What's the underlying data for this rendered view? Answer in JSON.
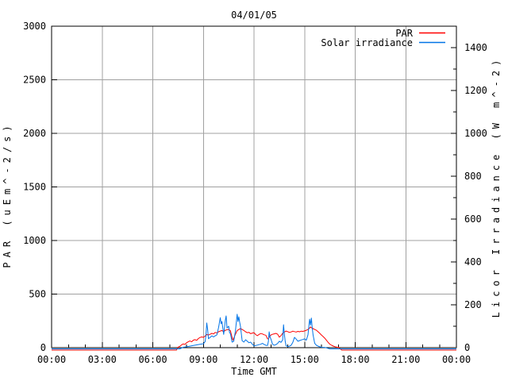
{
  "chart_data": {
    "type": "line",
    "title": "04/01/05",
    "xlabel": "Time GMT",
    "xlim": [
      0,
      24
    ],
    "x_ticks_hours": [
      0,
      3,
      6,
      9,
      12,
      15,
      18,
      21,
      24
    ],
    "x_tick_labels": [
      "00:00",
      "03:00",
      "06:00",
      "09:00",
      "12:00",
      "15:00",
      "18:00",
      "21:00",
      "00:00"
    ],
    "x_minor_step_hours": 1,
    "left_axis": {
      "label": "PAR (uEm^-2/s)",
      "lim": [
        0,
        3000
      ],
      "tick_step": 500,
      "tick_values": [
        0,
        500,
        1000,
        1500,
        2000,
        2500,
        3000
      ],
      "tick_labels": [
        "0",
        "500",
        "1000",
        "1500",
        "2000",
        "2500",
        "3000"
      ]
    },
    "right_axis": {
      "label": "Licor Irradiance (W m^-2)",
      "lim": [
        0,
        1500
      ],
      "tick_step": 200,
      "minor_step": 100,
      "tick_values": [
        0,
        200,
        400,
        600,
        800,
        1000,
        1200,
        1400
      ],
      "tick_labels": [
        "0",
        "200",
        "400",
        "600",
        "800",
        "1000",
        "1200",
        "1400"
      ]
    },
    "grid": {
      "shown": true,
      "color": "#a0a0a0"
    },
    "border_color": "#000000",
    "legend_position": "top-right-inside",
    "series": [
      {
        "name": "PAR",
        "color": "#ff0000",
        "axis": "left",
        "points": [
          [
            0,
            0
          ],
          [
            1,
            0
          ],
          [
            2,
            0
          ],
          [
            3,
            0
          ],
          [
            4,
            0
          ],
          [
            5,
            0
          ],
          [
            6,
            0
          ],
          [
            7,
            0
          ],
          [
            7.4,
            0
          ],
          [
            7.5,
            5
          ],
          [
            7.6,
            12
          ],
          [
            7.7,
            25
          ],
          [
            7.8,
            35
          ],
          [
            7.9,
            30
          ],
          [
            8.0,
            45
          ],
          [
            8.1,
            55
          ],
          [
            8.2,
            62
          ],
          [
            8.3,
            55
          ],
          [
            8.4,
            70
          ],
          [
            8.5,
            75
          ],
          [
            8.6,
            68
          ],
          [
            8.7,
            85
          ],
          [
            8.8,
            95
          ],
          [
            8.9,
            100
          ],
          [
            9.0,
            96
          ],
          [
            9.1,
            108
          ],
          [
            9.2,
            122
          ],
          [
            9.3,
            118
          ],
          [
            9.4,
            125
          ],
          [
            9.5,
            133
          ],
          [
            9.6,
            128
          ],
          [
            9.7,
            142
          ],
          [
            9.8,
            138
          ],
          [
            9.9,
            148
          ],
          [
            10.0,
            155
          ],
          [
            10.1,
            160
          ],
          [
            10.2,
            150
          ],
          [
            10.3,
            162
          ],
          [
            10.4,
            168
          ],
          [
            10.5,
            170
          ],
          [
            10.6,
            158
          ],
          [
            10.7,
            95
          ],
          [
            10.75,
            70
          ],
          [
            10.8,
            88
          ],
          [
            10.9,
            125
          ],
          [
            11.0,
            160
          ],
          [
            11.1,
            170
          ],
          [
            11.2,
            178
          ],
          [
            11.3,
            170
          ],
          [
            11.4,
            160
          ],
          [
            11.5,
            148
          ],
          [
            11.6,
            140
          ],
          [
            11.7,
            143
          ],
          [
            11.8,
            130
          ],
          [
            11.9,
            136
          ],
          [
            12.0,
            140
          ],
          [
            12.1,
            122
          ],
          [
            12.2,
            112
          ],
          [
            12.3,
            124
          ],
          [
            12.4,
            132
          ],
          [
            12.5,
            128
          ],
          [
            12.6,
            120
          ],
          [
            12.7,
            116
          ],
          [
            12.8,
            84
          ],
          [
            12.85,
            80
          ],
          [
            12.9,
            100
          ],
          [
            13.0,
            118
          ],
          [
            13.1,
            125
          ],
          [
            13.2,
            129
          ],
          [
            13.3,
            133
          ],
          [
            13.4,
            125
          ],
          [
            13.5,
            98
          ],
          [
            13.6,
            112
          ],
          [
            13.7,
            134
          ],
          [
            13.8,
            146
          ],
          [
            13.9,
            155
          ],
          [
            14.0,
            150
          ],
          [
            14.1,
            142
          ],
          [
            14.2,
            147
          ],
          [
            14.3,
            154
          ],
          [
            14.4,
            150
          ],
          [
            14.5,
            146
          ],
          [
            14.6,
            152
          ],
          [
            14.7,
            148
          ],
          [
            14.8,
            154
          ],
          [
            14.9,
            152
          ],
          [
            15.0,
            156
          ],
          [
            15.1,
            162
          ],
          [
            15.2,
            170
          ],
          [
            15.3,
            184
          ],
          [
            15.35,
            193
          ],
          [
            15.4,
            186
          ],
          [
            15.5,
            178
          ],
          [
            15.6,
            170
          ],
          [
            15.7,
            162
          ],
          [
            15.8,
            148
          ],
          [
            15.9,
            133
          ],
          [
            16.0,
            118
          ],
          [
            16.1,
            104
          ],
          [
            16.2,
            88
          ],
          [
            16.3,
            68
          ],
          [
            16.4,
            48
          ],
          [
            16.5,
            32
          ],
          [
            16.6,
            22
          ],
          [
            16.7,
            15
          ],
          [
            16.8,
            9
          ],
          [
            16.9,
            5
          ],
          [
            17.0,
            2
          ],
          [
            17.2,
            0
          ],
          [
            18,
            0
          ],
          [
            19,
            0
          ],
          [
            20,
            0
          ],
          [
            21,
            0
          ],
          [
            22,
            0
          ],
          [
            23,
            0
          ],
          [
            24,
            0
          ]
        ]
      },
      {
        "name": "Solar irradiance",
        "color": "#0073e6",
        "axis": "right",
        "points": [
          [
            0,
            0
          ],
          [
            1,
            0
          ],
          [
            2,
            0
          ],
          [
            3,
            0
          ],
          [
            4,
            0
          ],
          [
            5,
            0
          ],
          [
            6,
            0
          ],
          [
            7,
            0
          ],
          [
            7.6,
            0
          ],
          [
            7.8,
            2
          ],
          [
            8.0,
            4
          ],
          [
            8.2,
            7
          ],
          [
            8.4,
            10
          ],
          [
            8.6,
            13
          ],
          [
            8.8,
            16
          ],
          [
            9.0,
            18
          ],
          [
            9.1,
            28
          ],
          [
            9.15,
            55
          ],
          [
            9.2,
            115
          ],
          [
            9.25,
            85
          ],
          [
            9.3,
            42
          ],
          [
            9.4,
            48
          ],
          [
            9.5,
            55
          ],
          [
            9.6,
            50
          ],
          [
            9.7,
            55
          ],
          [
            9.8,
            60
          ],
          [
            9.9,
            95
          ],
          [
            10.0,
            140
          ],
          [
            10.05,
            112
          ],
          [
            10.1,
            122
          ],
          [
            10.2,
            62
          ],
          [
            10.3,
            128
          ],
          [
            10.35,
            148
          ],
          [
            10.4,
            92
          ],
          [
            10.5,
            100
          ],
          [
            10.55,
            70
          ],
          [
            10.6,
            66
          ],
          [
            10.7,
            26
          ],
          [
            10.8,
            30
          ],
          [
            10.9,
            78
          ],
          [
            11.0,
            156
          ],
          [
            11.05,
            122
          ],
          [
            11.1,
            144
          ],
          [
            11.15,
            120
          ],
          [
            11.2,
            98
          ],
          [
            11.3,
            32
          ],
          [
            11.4,
            26
          ],
          [
            11.5,
            37
          ],
          [
            11.6,
            30
          ],
          [
            11.7,
            23
          ],
          [
            11.8,
            26
          ],
          [
            11.9,
            16
          ],
          [
            12.0,
            8
          ],
          [
            12.1,
            10
          ],
          [
            12.2,
            12
          ],
          [
            12.3,
            14
          ],
          [
            12.4,
            16
          ],
          [
            12.5,
            20
          ],
          [
            12.6,
            15
          ],
          [
            12.7,
            11
          ],
          [
            12.8,
            10
          ],
          [
            12.85,
            28
          ],
          [
            12.9,
            74
          ],
          [
            12.95,
            50
          ],
          [
            13.0,
            40
          ],
          [
            13.1,
            16
          ],
          [
            13.2,
            11
          ],
          [
            13.3,
            14
          ],
          [
            13.4,
            20
          ],
          [
            13.5,
            30
          ],
          [
            13.6,
            25
          ],
          [
            13.7,
            36
          ],
          [
            13.75,
            107
          ],
          [
            13.8,
            62
          ],
          [
            13.85,
            30
          ],
          [
            13.9,
            9
          ],
          [
            14.0,
            5
          ],
          [
            14.1,
            7
          ],
          [
            14.2,
            11
          ],
          [
            14.3,
            25
          ],
          [
            14.4,
            48
          ],
          [
            14.5,
            40
          ],
          [
            14.6,
            30
          ],
          [
            14.7,
            33
          ],
          [
            14.8,
            36
          ],
          [
            14.9,
            38
          ],
          [
            15.0,
            41
          ],
          [
            15.1,
            35
          ],
          [
            15.2,
            60
          ],
          [
            15.25,
            100
          ],
          [
            15.3,
            133
          ],
          [
            15.35,
            105
          ],
          [
            15.4,
            138
          ],
          [
            15.45,
            95
          ],
          [
            15.5,
            60
          ],
          [
            15.6,
            20
          ],
          [
            15.7,
            11
          ],
          [
            15.8,
            7
          ],
          [
            15.9,
            4
          ],
          [
            16.0,
            2
          ],
          [
            16.2,
            1
          ],
          [
            16.5,
            0
          ],
          [
            17,
            0
          ],
          [
            18,
            0
          ],
          [
            19,
            0
          ],
          [
            20,
            0
          ],
          [
            21,
            0
          ],
          [
            22,
            0
          ],
          [
            23,
            0
          ],
          [
            24,
            0
          ]
        ]
      }
    ]
  }
}
